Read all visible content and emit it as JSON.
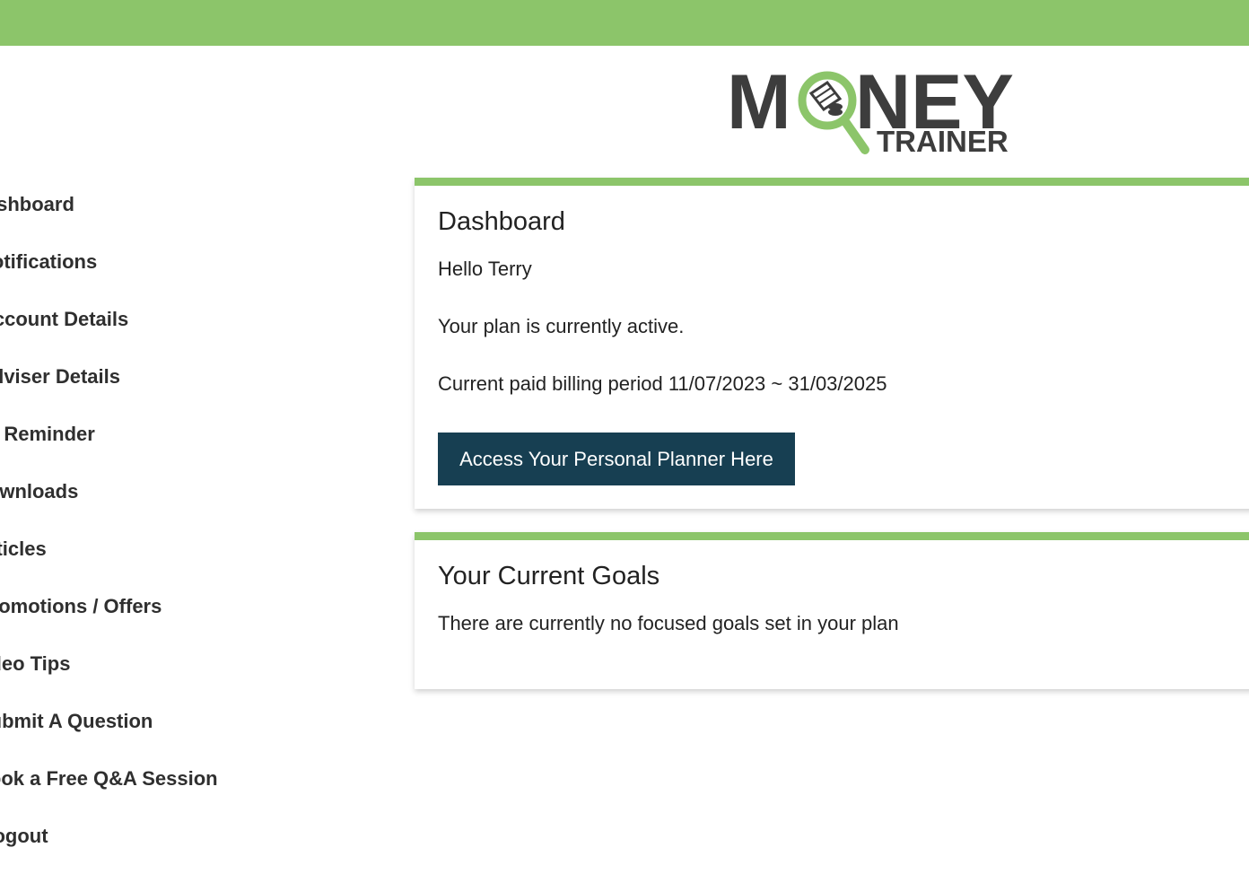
{
  "colors": {
    "accent_green": "#8cc56a",
    "button_navy": "#173f52",
    "text_dark": "#2f2f2f",
    "logo_gray": "#3d3d3d"
  },
  "logo": {
    "word_money": "MONEY",
    "word_trainer": "TRAINER"
  },
  "sidebar": {
    "items": [
      {
        "label": "Dashboard",
        "icon": ""
      },
      {
        "label": "Notifications",
        "icon": ""
      },
      {
        "label": "Account Details",
        "icon": ""
      },
      {
        "label": "Adviser Details",
        "icon": ""
      },
      {
        "label": "Set Reminder",
        "icon": ""
      },
      {
        "label": "Downloads",
        "icon": ""
      },
      {
        "label": "Articles",
        "icon": ""
      },
      {
        "label": "Promotions / Offers",
        "icon": ""
      },
      {
        "label": "Video Tips",
        "icon": ""
      },
      {
        "label": "Submit A Question",
        "icon": ""
      },
      {
        "label": "Book a Free Q&A Session",
        "icon": ""
      },
      {
        "label": "Logout",
        "icon": ""
      }
    ]
  },
  "dashboard": {
    "title": "Dashboard",
    "greeting": "Hello Terry",
    "plan_status": "Your plan is currently active.",
    "billing_period": "Current paid billing period 11/07/2023 ~ 31/03/2025",
    "planner_button": "Access Your Personal Planner Here"
  },
  "goals": {
    "title": "Your Current Goals",
    "empty_message": "There are currently no focused goals set in your plan"
  }
}
